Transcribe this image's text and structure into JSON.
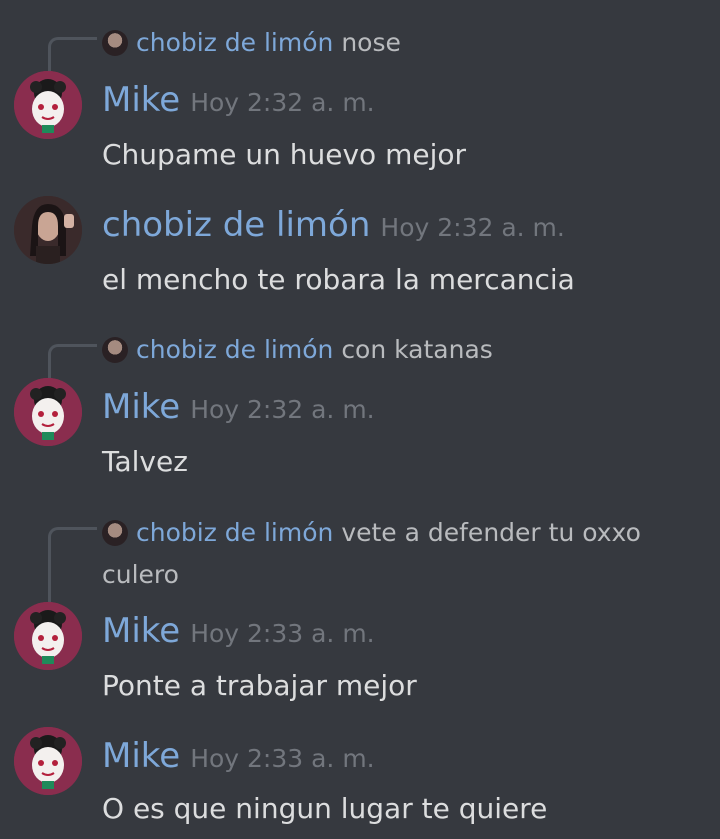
{
  "messages": [
    {
      "reply": {
        "name": "chobiz de limón",
        "text": "nose"
      },
      "author": "Mike",
      "time": "Hoy 2:32 a. m.",
      "content": "Chupame un huevo mejor"
    },
    {
      "author": "chobiz de limón",
      "time": "Hoy 2:32 a. m.",
      "content": "el mencho te robara la mercancia"
    },
    {
      "reply": {
        "name": "chobiz de limón",
        "text": "con katanas"
      },
      "author": "Mike",
      "time": "Hoy 2:32 a. m.",
      "content": "Talvez"
    },
    {
      "reply": {
        "name": "chobiz de limón",
        "text": "vete a defender tu oxxo",
        "text_cont": "culero"
      },
      "author": "Mike",
      "time": "Hoy 2:33 a. m.",
      "content": "Ponte a trabajar mejor"
    },
    {
      "author": "Mike",
      "time": "Hoy 2:33 a. m.",
      "content": "O es que ningun lugar te quiere"
    }
  ],
  "colors": {
    "background": "#36393f",
    "username": "#7ea8d9",
    "timestamp": "#72767d",
    "message_text": "#dcddde",
    "reply_text": "#b9bbbe"
  }
}
